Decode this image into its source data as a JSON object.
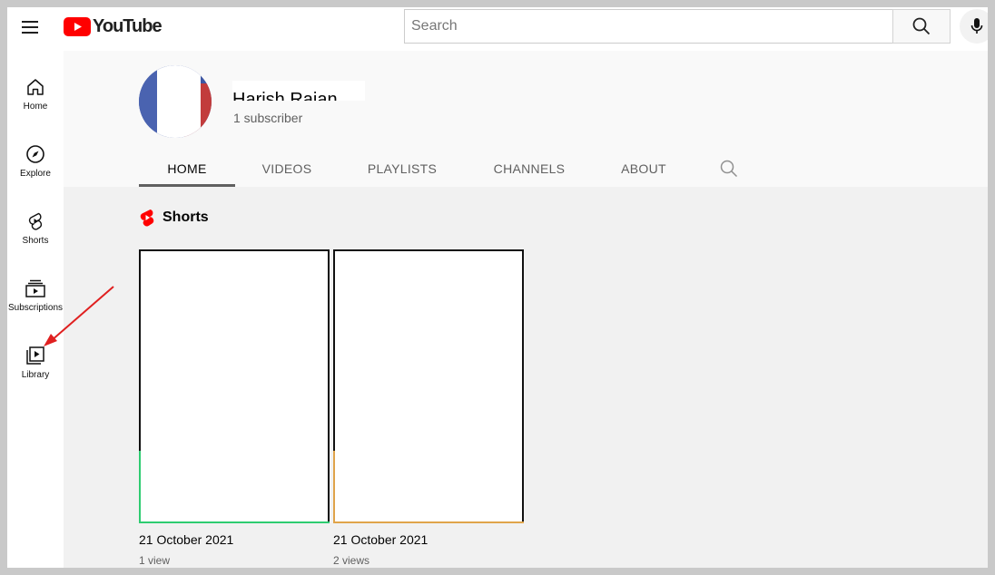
{
  "topbar": {
    "logo_text": "YouTube",
    "search_placeholder": "Search"
  },
  "sidebar": {
    "items": [
      {
        "label": "Home",
        "icon": "home-icon"
      },
      {
        "label": "Explore",
        "icon": "compass-icon"
      },
      {
        "label": "Shorts",
        "icon": "shorts-icon"
      },
      {
        "label": "Subscriptions",
        "icon": "subscriptions-icon"
      },
      {
        "label": "Library",
        "icon": "library-icon"
      }
    ]
  },
  "channel": {
    "name": "Harish Rajan",
    "subscribers": "1 subscriber",
    "tabs": [
      "HOME",
      "VIDEOS",
      "PLAYLISTS",
      "CHANNELS",
      "ABOUT"
    ]
  },
  "shorts": {
    "title": "Shorts",
    "items": [
      {
        "date": "21 October 2021",
        "views": "1 view",
        "accent": "#2ecc71"
      },
      {
        "date": "21 October 2021",
        "views": "2 views",
        "accent": "#e0a44a"
      }
    ]
  },
  "colors": {
    "brand_red": "#ff0000",
    "annotation_arrow": "#e02020"
  }
}
